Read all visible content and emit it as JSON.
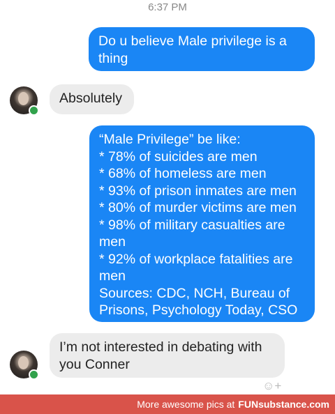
{
  "header": {
    "time": "6:37 PM"
  },
  "messages": [
    {
      "from": "me",
      "lines": [
        "Do u believe Male privilege is a",
        "thing"
      ]
    },
    {
      "from": "them",
      "lines": [
        "Absolutely"
      ]
    },
    {
      "from": "me",
      "lines": [
        "“Male Privilege” be like:",
        "* 78% of suicides are men",
        "* 68% of homeless are men",
        "* 93% of prison inmates are men",
        "* 80% of murder victims are men",
        "* 98% of military casualties are",
        "men",
        "* 92% of workplace fatalities are",
        "men",
        "Sources: CDC, NCH, Bureau of",
        "Prisons, Psychology Today, CSO"
      ]
    },
    {
      "from": "them",
      "lines": [
        "I’m not interested in debating with",
        "you Conner"
      ]
    }
  ],
  "icons": {
    "avatar": "profile-photo",
    "status": "online-dot",
    "reaction": "add-reaction-icon"
  },
  "colors": {
    "sent_bubble": "#1a86f5",
    "received_bubble": "#ececec",
    "online": "#31a24c",
    "footer": "#d9534a"
  },
  "footer": {
    "text": "More awesome pics at",
    "brand": "FUNsubstance.com"
  }
}
